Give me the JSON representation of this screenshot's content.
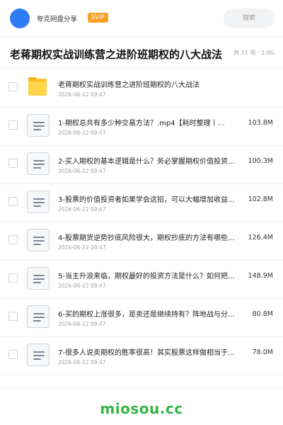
{
  "header": {
    "brand": "夸克网盘分享",
    "badge": "SVIP",
    "search_label": "搜索"
  },
  "share": {
    "title": "老蒋期权实战训练营之进阶班期权的八大战法",
    "meta": "共 11 项 · 1.0G"
  },
  "items": [
    {
      "name": "老蒋期权实战训练营之进阶班期权的八大战法",
      "date": "2026-06-22 09:47",
      "size": "",
      "icon": "folder-icon"
    },
    {
      "name": "1-期权总共有多少种交易方法？.mp4【耗时整理丨…",
      "date": "2026-06-22 09:47",
      "size": "103.8M",
      "icon": "file-icon"
    },
    {
      "name": "2-买入期权的基本逻辑是什么？务必掌握期权价值投资…",
      "date": "2026-06-22 09:47",
      "size": "100.3M",
      "icon": "file-icon"
    },
    {
      "name": "3-股票的价值投资者如果学会这招，可以大幅增加收益…",
      "date": "2026-06-22 09:47",
      "size": "102.8M",
      "icon": "file-icon"
    },
    {
      "name": "4-股票期货逆势抄底风险很大，期权抄底的方法有哪些…",
      "date": "2026-06-22 09:47",
      "size": "126.4M",
      "icon": "file-icon"
    },
    {
      "name": "5-当主升浪来临，期权最好的投资方法是什么？如何把…",
      "date": "2026-06-22 09:47",
      "size": "148.9M",
      "icon": "file-icon"
    },
    {
      "name": "6-买的期权上涨很多，是卖还是继续持有？阵地战与分…",
      "date": "2026-06-22 09:47",
      "size": "80.8M",
      "icon": "file-icon"
    },
    {
      "name": "7-很多人说卖期权的胜率很高！其实股票这样做相当于…",
      "date": "2026-06-22 09:47",
      "size": "78.0M",
      "icon": "file-icon"
    }
  ],
  "footer": {
    "watermark": "miosou.cc"
  },
  "colors": {
    "accent": "#2f7bf5",
    "badge": "#f6a126",
    "watermark": "#34b346",
    "folder": "#f7c32f"
  }
}
